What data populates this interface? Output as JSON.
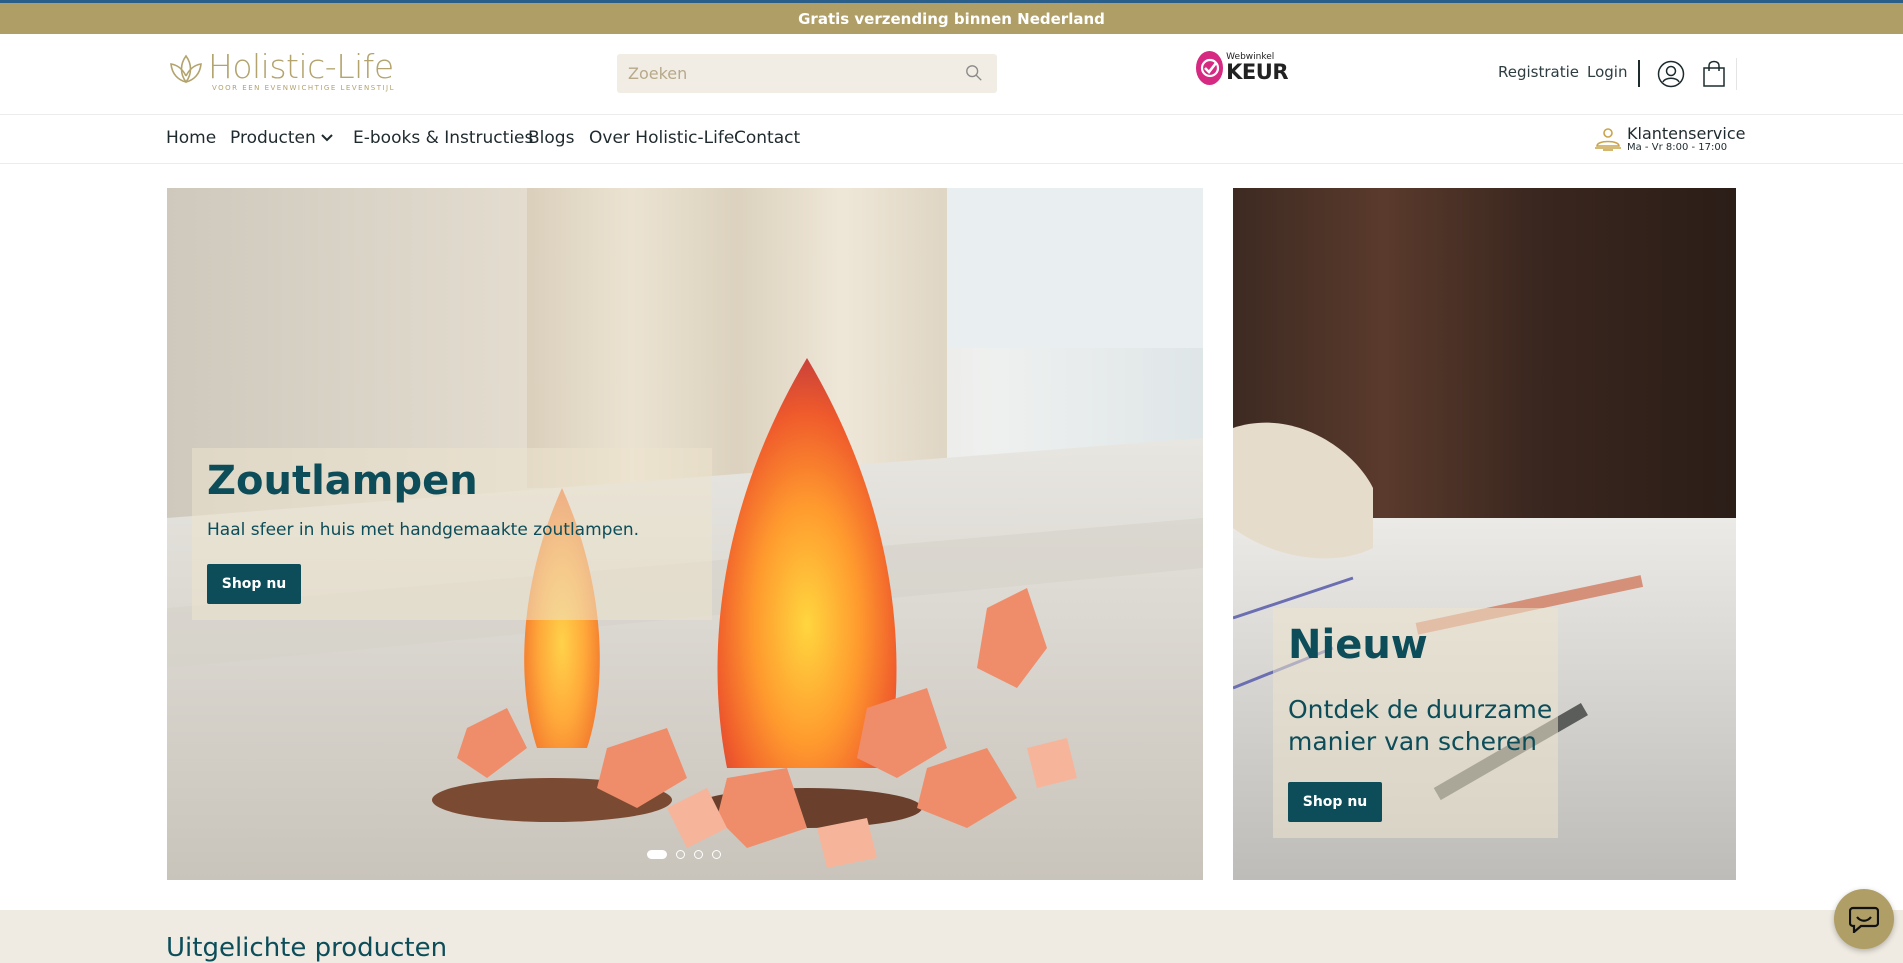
{
  "announcement": "Gratis verzending binnen Nederland",
  "header": {
    "logo_name": "Holistic-Life",
    "logo_tagline": "VOOR EEN EVENWICHTIGE LEVENSTIJL",
    "search_placeholder": "Zoeken",
    "badge_small": "Webwinkel",
    "badge_big": "KEUR",
    "register_label": "Registratie",
    "login_label": "Login"
  },
  "nav": {
    "items": [
      {
        "label": "Home"
      },
      {
        "label": "Producten"
      },
      {
        "label": "E-books & Instructies"
      },
      {
        "label": "Blogs"
      },
      {
        "label": "Over Holistic-Life"
      },
      {
        "label": "Contact"
      }
    ],
    "service_title": "Klantenservice",
    "service_hours": "Ma - Vr 8:00 - 17:00"
  },
  "hero_main": {
    "title": "Zoutlampen",
    "subtitle": "Haal sfeer in huis met handgemaakte zoutlampen.",
    "button": "Shop nu",
    "slides_total": 4,
    "active_slide": 1
  },
  "hero_side": {
    "title": "Nieuw",
    "subtitle_line1": "Ontdek de duurzame",
    "subtitle_line2": "manier van scheren",
    "button": "Shop nu"
  },
  "featured": {
    "heading": "Uitgelichte producten"
  },
  "colors": {
    "gold": "#b09e67",
    "teal": "#0c4d59",
    "beige": "#efebe2",
    "keur_pink": "#d62982"
  }
}
